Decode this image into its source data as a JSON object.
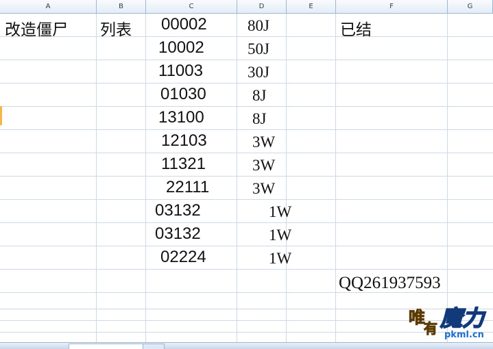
{
  "columns": [
    "A",
    "B",
    "C",
    "D",
    "E",
    "F",
    "G"
  ],
  "cells": {
    "a1": "改造僵尸",
    "b1": "列表",
    "f1": "已结",
    "qq": "QQ261937593"
  },
  "rows": [
    {
      "code": "00002",
      "amount": "80J"
    },
    {
      "code": "10002",
      "amount": "50J"
    },
    {
      "code": "11003",
      "amount": "30J"
    },
    {
      "code": "01030",
      "amount": "8J"
    },
    {
      "code": "13100",
      "amount": "8J"
    },
    {
      "code": "12103",
      "amount": "3W"
    },
    {
      "code": "11321",
      "amount": "3W"
    },
    {
      "code": "22111",
      "amount": "3W"
    },
    {
      "code": "03132",
      "amount": "1W"
    },
    {
      "code": "03132",
      "amount": "1W"
    },
    {
      "code": "02224",
      "amount": "1W"
    }
  ],
  "watermark": {
    "url": "pkml.cn"
  }
}
